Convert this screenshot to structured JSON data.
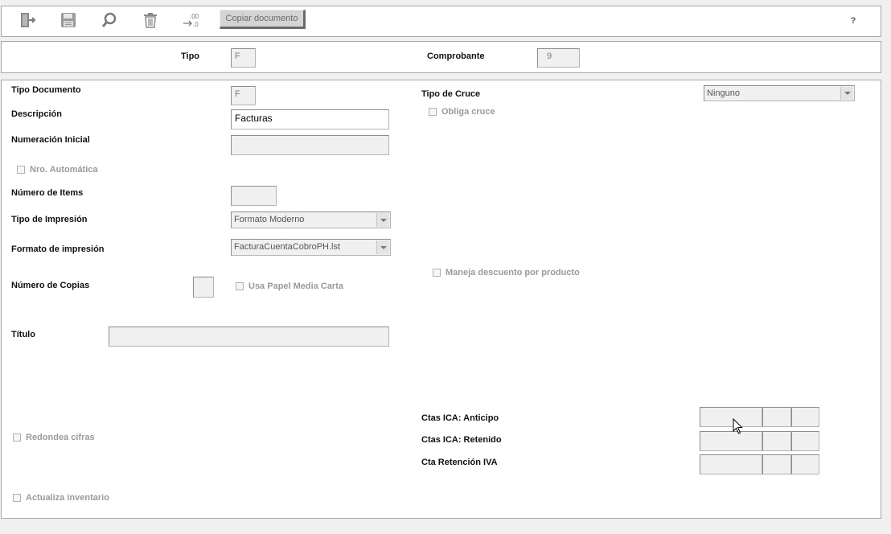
{
  "toolbar": {
    "copy_label": "Copiar documento",
    "help_label": "?",
    "icons": [
      "exit-icon",
      "save-icon",
      "search-icon",
      "trash-icon",
      "decimal-format-icon"
    ]
  },
  "header": {
    "tipo_label": "Tipo",
    "tipo_value": "F",
    "comprobante_label": "Comprobante",
    "comprobante_value": "9"
  },
  "form": {
    "tipo_documento_label": "Tipo Documento",
    "tipo_documento_value": "F",
    "descripcion_label": "Descripción",
    "descripcion_value": "Facturas",
    "numeracion_inicial_label": "Numeración Inicial",
    "numeracion_inicial_value": "",
    "nro_automatica_label": "Nro. Automática",
    "numero_items_label": "Número de Items",
    "numero_items_value": "",
    "tipo_impresion_label": "Tipo de Impresión",
    "tipo_impresion_value": "Formato Moderno",
    "formato_impresion_label": "Formato de impresión",
    "formato_impresion_value": "FacturaCuentaCobroPH.lst",
    "numero_copias_label": "Número de Copias",
    "numero_copias_value": "",
    "usa_papel_label": "Usa Papel Media Carta",
    "titulo_label": "Título",
    "titulo_value": "",
    "redondea_label": "Redondea cifras",
    "actualiza_label": "Actualiza inventario",
    "tipo_cruce_label": "Tipo de Cruce",
    "tipo_cruce_value": "Ninguno",
    "obliga_cruce_label": "Obliga cruce",
    "maneja_descuento_label": "Maneja descuento por producto",
    "ctas_ica_anticipo_label": "Ctas ICA: Anticipo",
    "ctas_ica_retenido_label": "Ctas ICA: Retenido",
    "cta_retencion_iva_label": "Cta Retención IVA"
  }
}
